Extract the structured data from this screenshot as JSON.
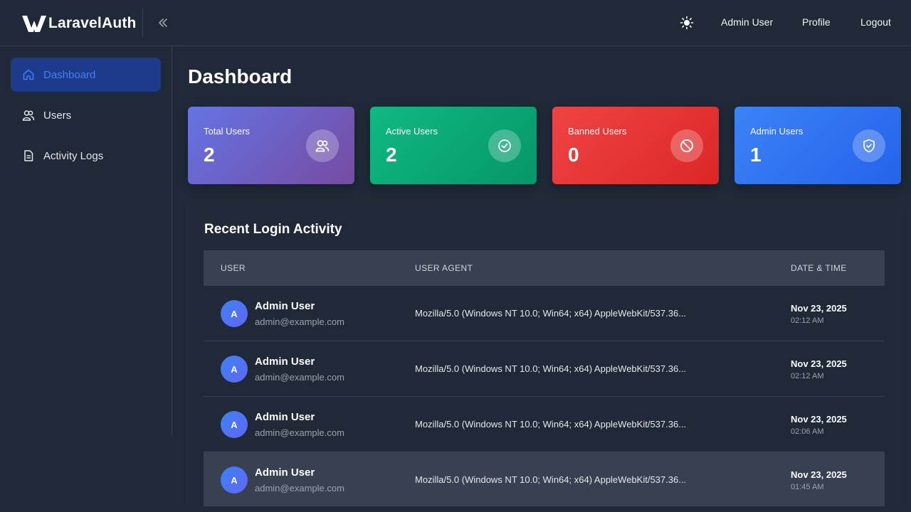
{
  "brand": {
    "name": "LaravelAuth"
  },
  "header": {
    "user_link": "Admin User",
    "profile_link": "Profile",
    "logout_link": "Logout"
  },
  "sidebar": {
    "items": [
      {
        "label": "Dashboard",
        "icon": "home-icon",
        "active": true
      },
      {
        "label": "Users",
        "icon": "users-icon",
        "active": false
      },
      {
        "label": "Activity Logs",
        "icon": "document-icon",
        "active": false
      }
    ]
  },
  "page": {
    "title": "Dashboard"
  },
  "stats": [
    {
      "label": "Total Users",
      "value": "2",
      "icon": "users-icon",
      "color_from": "#6474e4",
      "color_to": "#764ba2"
    },
    {
      "label": "Active Users",
      "value": "2",
      "icon": "check-circle-icon",
      "color_from": "#10b981",
      "color_to": "#059669"
    },
    {
      "label": "Banned Users",
      "value": "0",
      "icon": "ban-icon",
      "color_from": "#ef4444",
      "color_to": "#dc2626"
    },
    {
      "label": "Admin Users",
      "value": "1",
      "icon": "shield-check-icon",
      "color_from": "#3b82f6",
      "color_to": "#2563eb"
    }
  ],
  "activity": {
    "title": "Recent Login Activity",
    "columns": [
      "USER",
      "USER AGENT",
      "DATE & TIME"
    ],
    "rows": [
      {
        "initial": "A",
        "name": "Admin User",
        "email": "admin@example.com",
        "agent": "Mozilla/5.0 (Windows NT 10.0; Win64; x64) AppleWebKit/537.36...",
        "date": "Nov 23, 2025",
        "time": "02:12 AM"
      },
      {
        "initial": "A",
        "name": "Admin User",
        "email": "admin@example.com",
        "agent": "Mozilla/5.0 (Windows NT 10.0; Win64; x64) AppleWebKit/537.36...",
        "date": "Nov 23, 2025",
        "time": "02:12 AM"
      },
      {
        "initial": "A",
        "name": "Admin User",
        "email": "admin@example.com",
        "agent": "Mozilla/5.0 (Windows NT 10.0; Win64; x64) AppleWebKit/537.36...",
        "date": "Nov 23, 2025",
        "time": "02:06 AM"
      },
      {
        "initial": "A",
        "name": "Admin User",
        "email": "admin@example.com",
        "agent": "Mozilla/5.0 (Windows NT 10.0; Win64; x64) AppleWebKit/537.36...",
        "date": "Nov 23, 2025",
        "time": "01:45 AM"
      }
    ]
  }
}
